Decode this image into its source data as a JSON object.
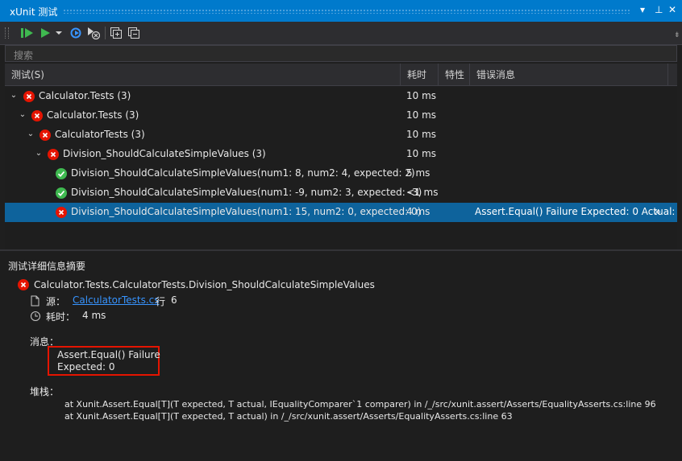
{
  "window": {
    "title": "xUnit 测试",
    "controls": [
      "▾",
      "⊥",
      "✕"
    ]
  },
  "toolbar": {
    "icons": [
      "run-all-icon",
      "run-icon",
      "run-dropdown-icon",
      "refresh-icon",
      "cancel-icon",
      "expand-all-icon",
      "collapse-all-icon"
    ]
  },
  "search": {
    "placeholder": "搜索"
  },
  "columns": {
    "test": "测试(S)",
    "duration": "耗时",
    "traits": "特性",
    "error": "错误消息"
  },
  "rows": [
    {
      "chevron": "⌄",
      "status": "fail",
      "name": "Calculator.Tests (3)",
      "duration": "10 ms",
      "error": "",
      "more": ""
    },
    {
      "chevron": "⌄",
      "status": "fail",
      "name": "Calculator.Tests (3)",
      "duration": "10 ms",
      "error": "",
      "more": ""
    },
    {
      "chevron": "⌄",
      "status": "fail",
      "name": "CalculatorTests (3)",
      "duration": "10 ms",
      "error": "",
      "more": ""
    },
    {
      "chevron": "⌄",
      "status": "fail",
      "name": "Division_ShouldCalculateSimpleValues (3)",
      "duration": "10 ms",
      "error": "",
      "more": ""
    },
    {
      "chevron": "",
      "status": "pass",
      "name": "Division_ShouldCalculateSimpleValues(num1: 8, num2: 4, expected: 2)",
      "duration": "5 ms",
      "error": "",
      "more": ""
    },
    {
      "chevron": "",
      "status": "pass",
      "name": "Division_ShouldCalculateSimpleValues(num1: -9, num2: 3, expected: -3)",
      "duration": "<1 ms",
      "error": "",
      "more": ""
    },
    {
      "chevron": "",
      "status": "fail",
      "name": "Division_ShouldCalculateSimpleValues(num1: 15, num2: 0, expected: 0)",
      "duration": "4 ms",
      "error": "Assert.Equal() Failure Expected: 0 Actual:",
      "more": "∞"
    }
  ],
  "detail": {
    "heading": "测试详细信息摘要",
    "test_name": "Calculator.Tests.CalculatorTests.Division_ShouldCalculateSimpleValues",
    "source_label": "源：",
    "source_file": "CalculatorTests.cs",
    "line_label": "行",
    "line_number": "6",
    "duration_label": "耗时：",
    "duration_value": "4 ms",
    "message_label": "消息：",
    "message_line1": "Assert.Equal() Failure",
    "message_line2": "Expected: 0",
    "stack_label": "堆栈：",
    "stack_line1": "at Xunit.Assert.Equal[T](T expected, T actual, IEqualityComparer`1 comparer) in /_/src/xunit.assert/Asserts/EqualityAsserts.cs:line 96",
    "stack_line2": "at Xunit.Assert.Equal[T](T expected, T actual) in /_/src/xunit.assert/Asserts/EqualityAsserts.cs:line 63"
  },
  "colors": {
    "accent": "#007acc",
    "fail": "#e51400",
    "pass": "#3fb950",
    "selection": "#0e639c",
    "link": "#3794ff"
  }
}
